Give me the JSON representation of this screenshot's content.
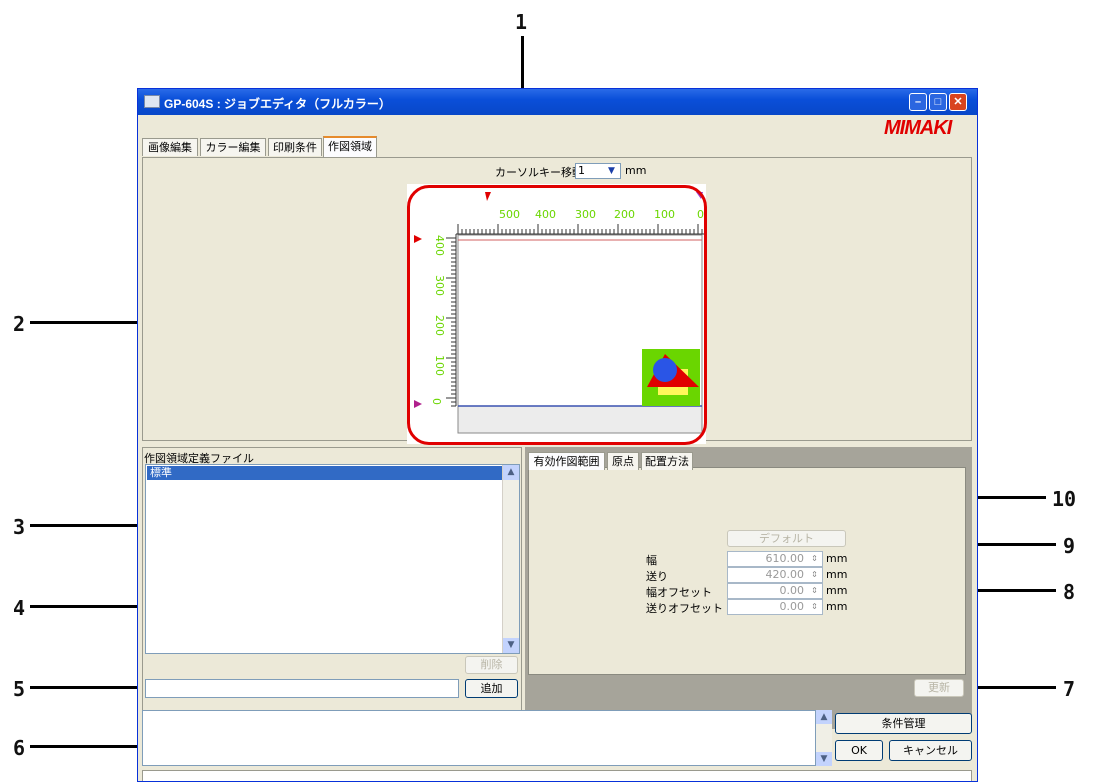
{
  "callouts": [
    "1",
    "2",
    "3",
    "4",
    "5",
    "6",
    "7",
    "8",
    "9",
    "10"
  ],
  "window": {
    "title": "GP-604S : ジョブエディタ（フルカラー）",
    "brand": "MIMAKI",
    "tabs": [
      "画像編集",
      "カラー編集",
      "印刷条件",
      "作図領域"
    ],
    "active_tab": "作図領域"
  },
  "cursor_step": {
    "label": "カーソルキー移動量",
    "value": "1",
    "unit": "mm"
  },
  "preview": {
    "x_ticks": [
      "500",
      "400",
      "300",
      "200",
      "100",
      "0"
    ],
    "y_ticks": [
      "400",
      "300",
      "200",
      "100",
      "0"
    ]
  },
  "file_list": {
    "title": "作図領域定義ファイル",
    "items": [
      "標準"
    ],
    "delete_label": "削除",
    "add_label": "追加",
    "name_input_value": ""
  },
  "settings": {
    "tabs": [
      "有効作図範囲",
      "原点",
      "配置方法"
    ],
    "default_label": "デフォルト",
    "fields": [
      {
        "label": "幅",
        "value": "610.00",
        "unit": "mm"
      },
      {
        "label": "送り",
        "value": "420.00",
        "unit": "mm"
      },
      {
        "label": "幅オフセット",
        "value": "0.00",
        "unit": "mm"
      },
      {
        "label": "送りオフセット",
        "value": "0.00",
        "unit": "mm"
      }
    ],
    "update_label": "更新"
  },
  "footer": {
    "condition_label": "条件管理",
    "ok_label": "OK",
    "cancel_label": "キャンセル"
  },
  "colors": {
    "title_bar": "#0a4fd9",
    "highlight": "#e00000",
    "accent_green": "#6ad600",
    "selection": "#316ac5"
  }
}
